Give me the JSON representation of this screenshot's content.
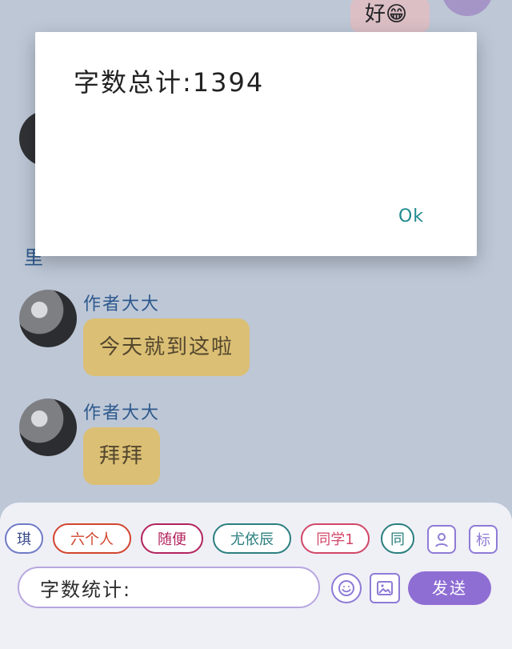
{
  "chat": {
    "top_reply_text": "好😁",
    "partial_name_text": "里",
    "messages": [
      {
        "author": "作者大大",
        "text": "今天就到这啦"
      },
      {
        "author": "作者大大",
        "text": "拜拜"
      }
    ]
  },
  "dialog": {
    "message": "字数总计:1394",
    "ok_label": "Ok"
  },
  "quick_replies": {
    "chips": [
      "琪",
      "六个人",
      "随便",
      "尤依辰",
      "同学1",
      "同"
    ]
  },
  "toolbar_icons": {
    "profile_icon": "person-icon",
    "tag_icon_text": "标"
  },
  "input": {
    "value": "字数统计:",
    "send_label": "发送"
  },
  "colors": {
    "accent": "#8f6ed4",
    "bubble_yellow": "#f4d37a",
    "reply_pink": "#f4d3d6"
  }
}
